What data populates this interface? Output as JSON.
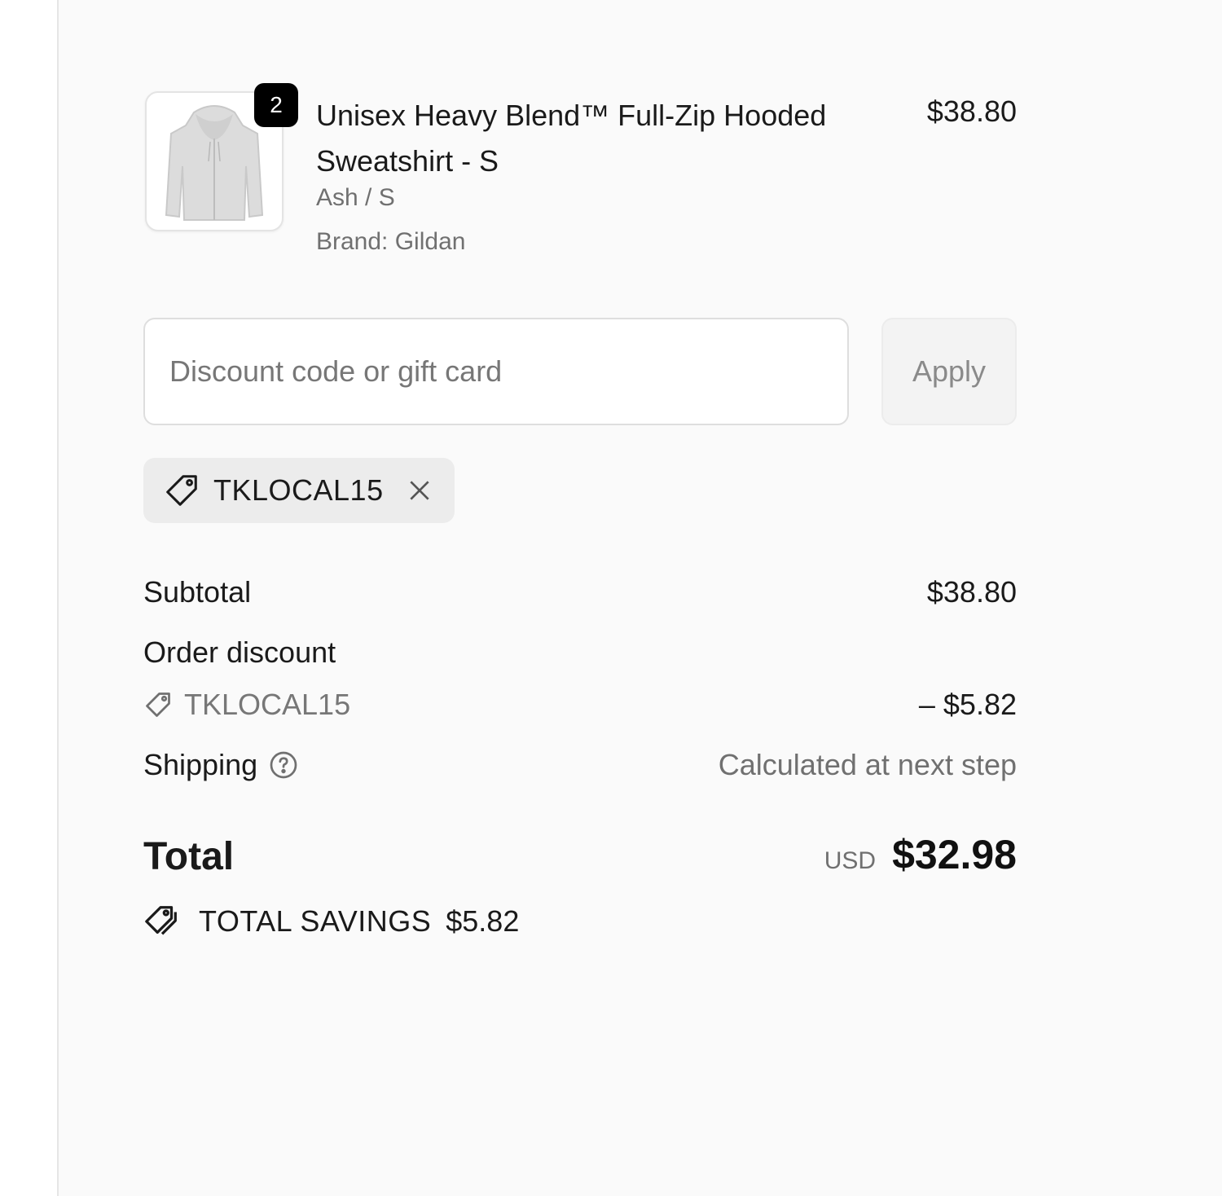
{
  "product": {
    "quantity": "2",
    "title": "Unisex Heavy Blend™ Full-Zip Hooded Sweatshirt - S",
    "variant": "Ash / S",
    "brand": "Brand: Gildan",
    "price": "$38.80",
    "image_icon": "hoodie-icon"
  },
  "discount": {
    "placeholder": "Discount code or gift card",
    "value": "",
    "apply_label": "Apply",
    "applied_code": "TKLOCAL15",
    "tag_icon": "tag-icon",
    "remove_icon": "close-icon"
  },
  "summary": {
    "subtotal_label": "Subtotal",
    "subtotal_value": "$38.80",
    "order_discount_label": "Order discount",
    "discount_code": "TKLOCAL15",
    "discount_value": "– $5.82",
    "shipping_label": "Shipping",
    "shipping_value": "Calculated at next step",
    "shipping_help_icon": "help-circle-icon",
    "total_label": "Total",
    "currency": "USD",
    "total_value": "$32.98",
    "savings_label": "TOTAL SAVINGS",
    "savings_value": "$5.82",
    "savings_icon": "tags-icon"
  }
}
